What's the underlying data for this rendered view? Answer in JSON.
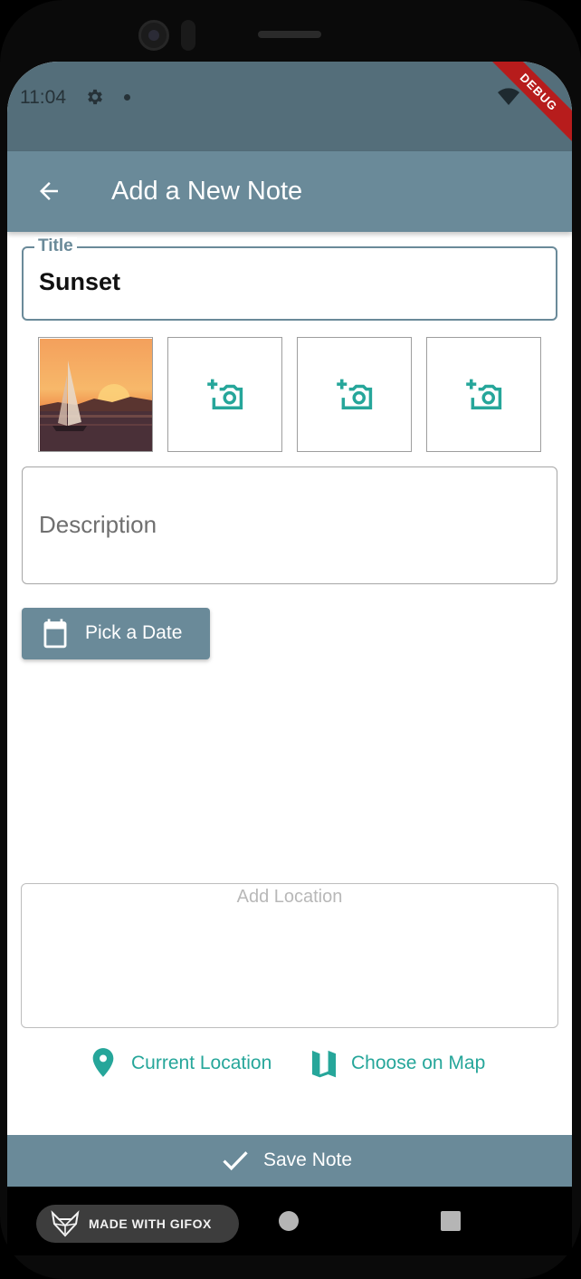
{
  "status_bar": {
    "time": "11:04",
    "debug_label": "DEBUG"
  },
  "app_bar": {
    "title": "Add a New Note"
  },
  "title_field": {
    "label": "Title",
    "value": "Sunset"
  },
  "photos": {
    "slots": [
      {
        "state": "filled"
      },
      {
        "state": "empty",
        "icon": "add-a-photo-icon"
      },
      {
        "state": "empty",
        "icon": "add-a-photo-icon"
      },
      {
        "state": "empty",
        "icon": "add-a-photo-icon"
      }
    ]
  },
  "description_field": {
    "placeholder": "Description"
  },
  "date_button": {
    "label": "Pick a Date",
    "icon": "calendar-icon"
  },
  "location": {
    "placeholder": "Add Location",
    "current_label": "Current Location",
    "map_label": "Choose on Map"
  },
  "save_button": {
    "label": "Save Note",
    "icon": "check-icon"
  },
  "overlay": {
    "gifox_text": "MADE WITH GIFOX"
  },
  "colors": {
    "status_bar": "#546e7a",
    "app_bar": "#6a8a99",
    "accent": "#26a69a",
    "debug": "#b71c1c"
  }
}
